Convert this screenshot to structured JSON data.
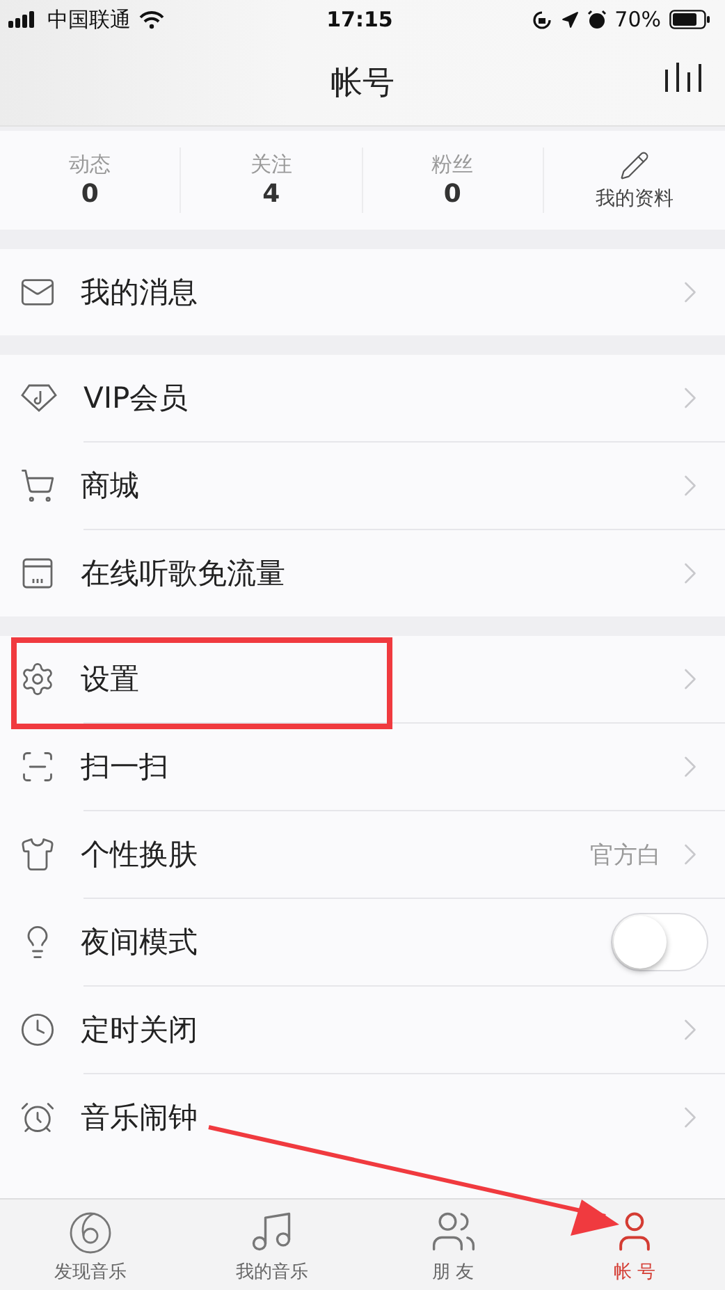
{
  "status_bar": {
    "carrier": "中国联通",
    "time": "17:15",
    "battery": "70%"
  },
  "nav_bar": {
    "title": "帐号"
  },
  "stats": [
    {
      "label": "动态",
      "value": "0"
    },
    {
      "label": "关注",
      "value": "4"
    },
    {
      "label": "粉丝",
      "value": "0"
    }
  ],
  "profile_link": {
    "label": "我的资料"
  },
  "groups": [
    [
      {
        "label": "我的消息",
        "kind": "link"
      }
    ],
    [
      {
        "label": "VIP会员",
        "kind": "link"
      },
      {
        "label": "商城",
        "kind": "link"
      },
      {
        "label": "在线听歌免流量",
        "kind": "link"
      }
    ],
    [
      {
        "label": "设置",
        "kind": "link",
        "highlighted": true
      },
      {
        "label": "扫一扫",
        "kind": "link"
      },
      {
        "label": "个性换肤",
        "kind": "value",
        "value": "官方白"
      },
      {
        "label": "夜间模式",
        "kind": "toggle",
        "on": false
      },
      {
        "label": "定时关闭",
        "kind": "link"
      },
      {
        "label": "音乐闹钟",
        "kind": "link"
      }
    ]
  ],
  "tabs": [
    {
      "label": "发现音乐",
      "selected": false
    },
    {
      "label": "我的音乐",
      "selected": false
    },
    {
      "label": "朋 友",
      "selected": false
    },
    {
      "label": "帐 号",
      "selected": true,
      "pointed": true
    }
  ]
}
